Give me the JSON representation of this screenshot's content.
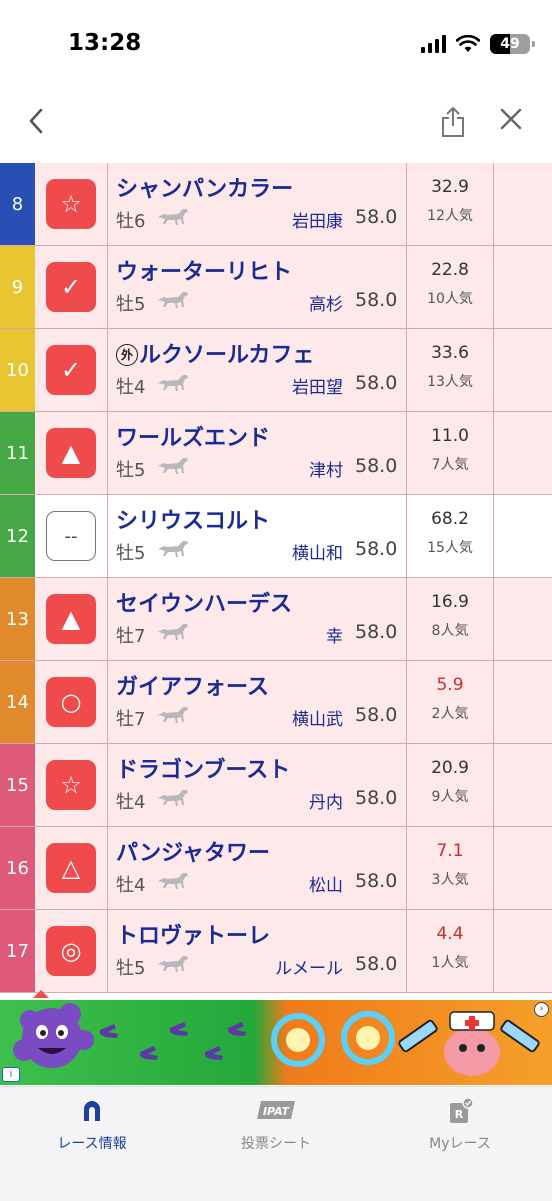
{
  "status": {
    "time": "13:28",
    "battery": "49"
  },
  "nav": {
    "back_icon": "chevron-left-icon",
    "share_icon": "share-icon",
    "close_icon": "close-icon"
  },
  "colors": {
    "row_pink": "#fde8ea",
    "mark_red": "#ef4a4c",
    "name_blue": "#1a2a96",
    "odds_red": "#d22a2a"
  },
  "rows": [
    {
      "num": "8",
      "frame_color": "#2a4fb4",
      "mark": "☆",
      "name": "シャンパンカラー",
      "gai": "",
      "sex": "牡6",
      "jockey": "岩田康",
      "weight": "58.0",
      "odds": "32.9",
      "odds_red": false,
      "pop": "12人気",
      "bg": "pink"
    },
    {
      "num": "9",
      "frame_color": "#e9c531",
      "mark": "✓",
      "name": "ウォーターリヒト",
      "gai": "",
      "sex": "牡5",
      "jockey": "高杉",
      "weight": "58.0",
      "odds": "22.8",
      "odds_red": false,
      "pop": "10人気",
      "bg": "pink"
    },
    {
      "num": "10",
      "frame_color": "#e9c531",
      "mark": "✓",
      "name": "ルクソールカフェ",
      "gai": "外",
      "sex": "牡4",
      "jockey": "岩田望",
      "weight": "58.0",
      "odds": "33.6",
      "odds_red": false,
      "pop": "13人気",
      "bg": "pink"
    },
    {
      "num": "11",
      "frame_color": "#45a845",
      "mark": "▲",
      "name": "ワールズエンド",
      "gai": "",
      "sex": "牡5",
      "jockey": "津村",
      "weight": "58.0",
      "odds": "11.0",
      "odds_red": false,
      "pop": "7人気",
      "bg": "pink"
    },
    {
      "num": "12",
      "frame_color": "#45a845",
      "mark": "--",
      "name": "シリウスコルト",
      "gai": "",
      "sex": "牡5",
      "jockey": "横山和",
      "weight": "58.0",
      "odds": "68.2",
      "odds_red": false,
      "pop": "15人気",
      "bg": "white"
    },
    {
      "num": "13",
      "frame_color": "#e08a2c",
      "mark": "▲",
      "name": "セイウンハーデス",
      "gai": "",
      "sex": "牡7",
      "jockey": "幸",
      "weight": "58.0",
      "odds": "16.9",
      "odds_red": false,
      "pop": "8人気",
      "bg": "pink"
    },
    {
      "num": "14",
      "frame_color": "#e08a2c",
      "mark": "○",
      "name": "ガイアフォース",
      "gai": "",
      "sex": "牡7",
      "jockey": "横山武",
      "weight": "58.0",
      "odds": "5.9",
      "odds_red": true,
      "pop": "2人気",
      "bg": "pink"
    },
    {
      "num": "15",
      "frame_color": "#de5a78",
      "mark": "☆",
      "name": "ドラゴンブースト",
      "gai": "",
      "sex": "牡4",
      "jockey": "丹内",
      "weight": "58.0",
      "odds": "20.9",
      "odds_red": false,
      "pop": "9人気",
      "bg": "pink"
    },
    {
      "num": "16",
      "frame_color": "#de5a78",
      "mark": "△",
      "name": "パンジャタワー",
      "gai": "",
      "sex": "牡4",
      "jockey": "松山",
      "weight": "58.0",
      "odds": "7.1",
      "odds_red": true,
      "pop": "3人気",
      "bg": "pink"
    },
    {
      "num": "17",
      "frame_color": "#de5a78",
      "mark": "◎",
      "name": "トロヴァトーレ",
      "gai": "",
      "sex": "牡5",
      "jockey": "ルメール",
      "weight": "58.0",
      "odds": "4.4",
      "odds_red": true,
      "pop": "1人気",
      "bg": "pink"
    }
  ],
  "tabs": [
    {
      "label": "レース情報",
      "icon": "horseshoe-icon",
      "active": true
    },
    {
      "label": "投票シート",
      "icon": "ipat-icon",
      "icon_text": "IPAT",
      "active": false
    },
    {
      "label": "Myレース",
      "icon": "my-race-icon",
      "icon_text": "R",
      "active": false
    }
  ]
}
